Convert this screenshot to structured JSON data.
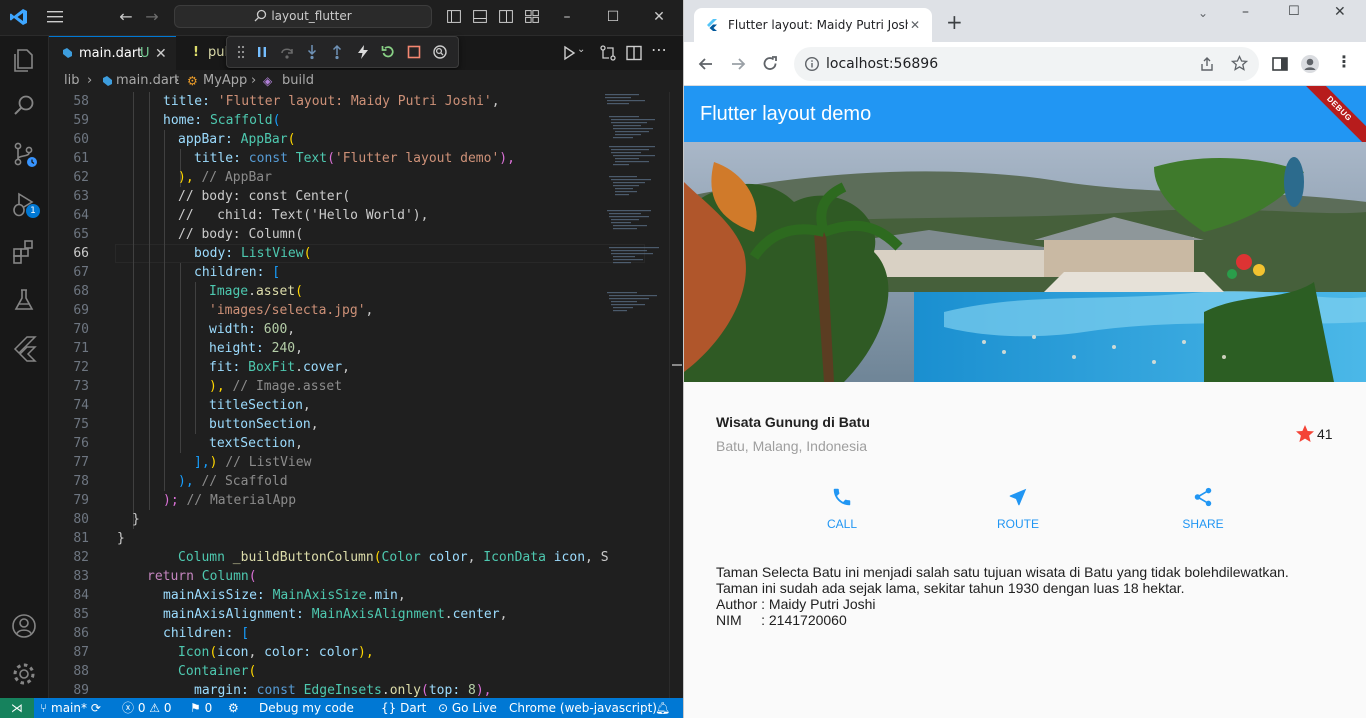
{
  "vscode": {
    "search_text": "layout_flutter",
    "tabs": [
      {
        "label": "main.dart",
        "status": "U"
      },
      {
        "label": "pul"
      }
    ],
    "breadcrumb": [
      "lib",
      "main.dart",
      "MyApp",
      "build"
    ],
    "scm_badge": "1",
    "status": {
      "branch": "main*",
      "errors": "0",
      "warnings": "0",
      "info": "0",
      "debug": "Debug my code",
      "language": "Dart",
      "golive": "Go Live",
      "target": "Chrome (web-javascript)"
    },
    "colors": {
      "accent": "#0078d4",
      "editor_bg": "#1f1f1f"
    }
  },
  "code": [
    {
      "n": "58"
    },
    {
      "n": "59"
    },
    {
      "n": "60"
    },
    {
      "n": "61"
    },
    {
      "n": "62"
    },
    {
      "n": "63"
    },
    {
      "n": "64"
    },
    {
      "n": "65"
    },
    {
      "n": "66"
    },
    {
      "n": "67"
    },
    {
      "n": "68"
    },
    {
      "n": "69"
    },
    {
      "n": "70"
    },
    {
      "n": "71"
    },
    {
      "n": "72"
    },
    {
      "n": "73"
    },
    {
      "n": "74"
    },
    {
      "n": "75"
    },
    {
      "n": "76"
    },
    {
      "n": "77"
    },
    {
      "n": "78"
    },
    {
      "n": "79"
    },
    {
      "n": "80"
    },
    {
      "n": "81"
    },
    {
      "n": "82"
    },
    {
      "n": "83"
    },
    {
      "n": "84"
    },
    {
      "n": "85"
    },
    {
      "n": "86"
    },
    {
      "n": "87"
    },
    {
      "n": "88"
    },
    {
      "n": "89"
    }
  ],
  "code_text": {
    "l58": [
      "title: ",
      "'Flutter layout: Maidy Putri Joshi'",
      ","
    ],
    "l59": [
      "home: ",
      "Scaffold",
      "("
    ],
    "l60": [
      "appBar: ",
      "AppBar",
      "("
    ],
    "l61": [
      "title: ",
      "const ",
      "Text",
      "(",
      "'Flutter layout demo'",
      "),"
    ],
    "l62": [
      "), ",
      "// AppBar"
    ],
    "l63": [
      "// body: const Center("
    ],
    "l64": [
      "//   child: Text('Hello World'),"
    ],
    "l65": [
      "// body: Column("
    ],
    "l66": [
      "body: ",
      "ListView",
      "("
    ],
    "l67": [
      "children: ",
      "["
    ],
    "l68": [
      "Image",
      ".",
      "asset",
      "("
    ],
    "l69": [
      "'images/selecta.jpg'",
      ","
    ],
    "l70": [
      "width: ",
      "600",
      ","
    ],
    "l71": [
      "height: ",
      "240",
      ","
    ],
    "l72": [
      "fit: ",
      "BoxFit",
      ".",
      "cover",
      ","
    ],
    "l73": [
      "), ",
      "// Image.asset"
    ],
    "l74": [
      "titleSection",
      ","
    ],
    "l75": [
      "buttonSection",
      ","
    ],
    "l76": [
      "textSection",
      ","
    ],
    "l77": [
      "],",
      ") ",
      "// ListView"
    ],
    "l78": [
      "), ",
      "// Scaffold"
    ],
    "l79": [
      ");",
      " // MaterialApp"
    ],
    "l80": [
      "}"
    ],
    "l81": [
      "}"
    ],
    "l82": [
      "Column ",
      "_buildButtonColumn",
      "(",
      "Color ",
      "color",
      ", ",
      "IconData ",
      "icon",
      ", S"
    ],
    "l83": [
      "return ",
      "Column",
      "("
    ],
    "l84": [
      "mainAxisSize: ",
      "MainAxisSize",
      ".",
      "min",
      ","
    ],
    "l85": [
      "mainAxisAlignment: ",
      "MainAxisAlignment",
      ".",
      "center",
      ","
    ],
    "l86": [
      "children: ",
      "["
    ],
    "l87": [
      "Icon",
      "(",
      "icon",
      ", ",
      "color: ",
      "color",
      "),"
    ],
    "l88": [
      "Container",
      "("
    ],
    "l89": [
      "margin: ",
      "const ",
      "EdgeInsets",
      ".",
      "only",
      "(",
      "top: ",
      "8",
      "),"
    ]
  },
  "chrome": {
    "tab_title": "Flutter layout: Maidy Putri Joshi",
    "url": "localhost:56896"
  },
  "app": {
    "appbar_title": "Flutter layout demo",
    "debug_banner": "DEBUG",
    "primary_color": "#2196f3",
    "title": "Wisata Gunung di Batu",
    "subtitle": "Batu, Malang, Indonesia",
    "favorite_count": "41",
    "star_color": "#f44336",
    "buttons": [
      {
        "label": "CALL",
        "icon": "phone-icon"
      },
      {
        "label": "ROUTE",
        "icon": "navigation-icon"
      },
      {
        "label": "SHARE",
        "icon": "share-icon"
      }
    ],
    "text_lines": [
      "Taman Selecta Batu ini menjadi salah satu tujuan wisata di Batu yang tidak bolehdilewatkan.",
      "Taman ini sudah ada sejak lama, sekitar tahun 1930 dengan luas 18 hektar.",
      "Author : Maidy Putri Joshi",
      "NIM     : 2141720060"
    ]
  }
}
